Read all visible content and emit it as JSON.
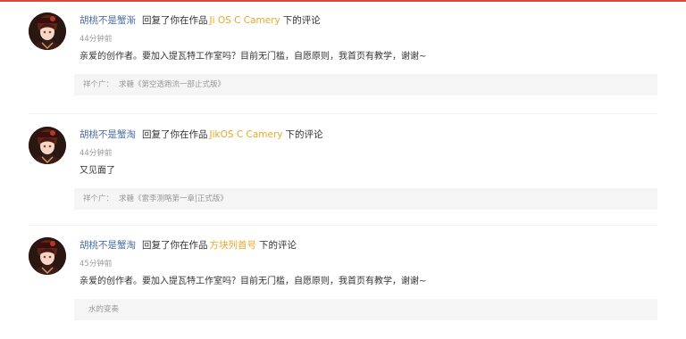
{
  "colors": {
    "accent_red": "#d94a3a",
    "nickname": "#4a6fa5",
    "work_title": "#e5a72d",
    "muted": "#999999",
    "quote_bg": "#f5f5f5"
  },
  "comments": [
    {
      "avatar_icon": "user-avatar-icon",
      "nickname": "胡桃不是蟹渐",
      "verb": "回复了你在作品",
      "work_title": "Ji OS C Camery",
      "tail": "下的评论",
      "time": "44分钟前",
      "body": "亲爱的创作者。要加入提瓦特工作室吗？目前无门槛，自愿原则，我首页有教学，谢谢~",
      "quote_label": "祥个广：",
      "quote_text": "求糖《第空透跑流一部止式版》"
    },
    {
      "avatar_icon": "user-avatar-icon",
      "nickname": "胡桃不是蟹淘",
      "verb": "回复了你在作品",
      "work_title": "JikOS C Camery",
      "tail": "下的评论",
      "time": "44分钟前",
      "body": "又见面了",
      "quote_label": "祥个广：",
      "quote_text": "求糖《雷李测略第一章|正式版》"
    },
    {
      "avatar_icon": "user-avatar-icon",
      "nickname": "胡桃不是蟹淘",
      "verb": "回复了你在作品",
      "work_title": "方块列首号",
      "tail": "下的评论",
      "time": "45分钟前",
      "body": "亲爱的创作者。要加入提瓦特工作室吗？目前无门槛，自愿原则，我首页有教学，谢谢~",
      "quote_label": "",
      "quote_text": "水的变奏"
    }
  ]
}
